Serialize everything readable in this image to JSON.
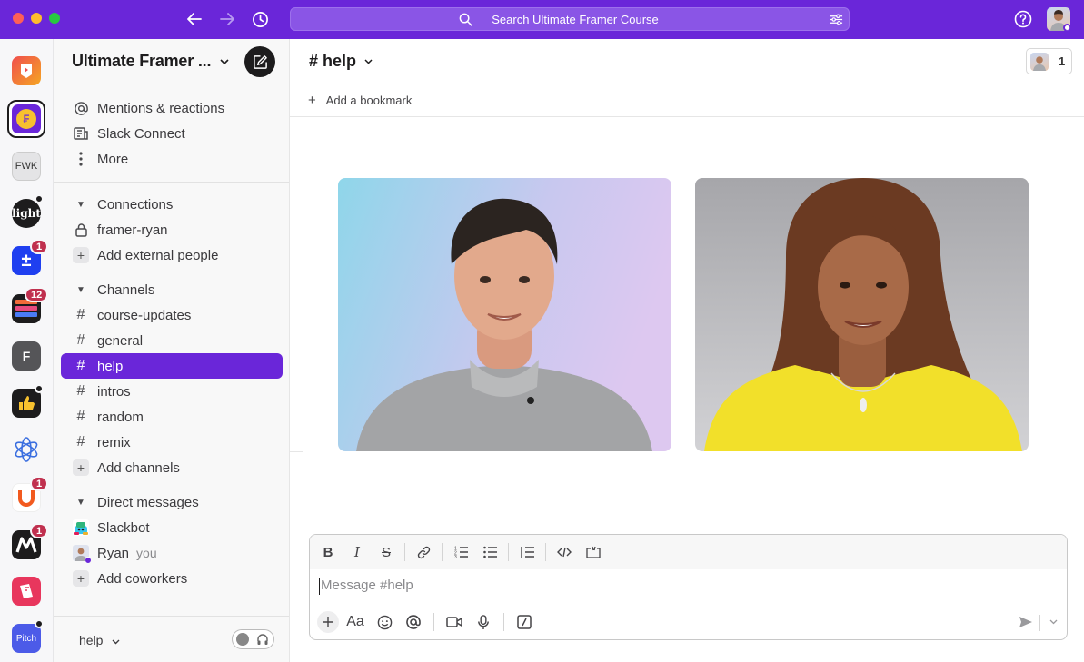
{
  "titlebar": {
    "search_placeholder": "Search Ultimate Framer Course"
  },
  "rail": {
    "workspaces": [
      {
        "name": "workspace-1",
        "label": ""
      },
      {
        "name": "ultimate-framer-course",
        "label": "",
        "active": true
      },
      {
        "name": "fwk",
        "label": "FWK"
      },
      {
        "name": "light",
        "label": "light",
        "dot": true
      },
      {
        "name": "workspace-plusminus",
        "label": "±",
        "badge": "1"
      },
      {
        "name": "workspace-stack",
        "label": "",
        "badge": "12"
      },
      {
        "name": "workspace-f",
        "label": "F"
      },
      {
        "name": "workspace-thumbs",
        "label": "",
        "dot": true
      },
      {
        "name": "workspace-flower",
        "label": ""
      },
      {
        "name": "workspace-u",
        "label": "",
        "badge": "1"
      },
      {
        "name": "workspace-m",
        "label": "",
        "badge": "1"
      },
      {
        "name": "workspace-red",
        "label": ""
      },
      {
        "name": "pitch",
        "label": "Pitch",
        "dot": true
      }
    ]
  },
  "sidebar": {
    "workspace_name": "Ultimate Framer ...",
    "top_items": [
      {
        "label": "Mentions & reactions"
      },
      {
        "label": "Slack Connect"
      },
      {
        "label": "More"
      }
    ],
    "connections": {
      "title": "Connections",
      "items": [
        {
          "label": "framer-ryan"
        },
        {
          "label": "Add external people"
        }
      ]
    },
    "channels": {
      "title": "Channels",
      "items": [
        {
          "label": "course-updates"
        },
        {
          "label": "general"
        },
        {
          "label": "help",
          "active": true
        },
        {
          "label": "intros"
        },
        {
          "label": "random"
        },
        {
          "label": "remix"
        },
        {
          "label": "Add channels"
        }
      ]
    },
    "direct_messages": {
      "title": "Direct messages",
      "items": [
        {
          "label": "Slackbot"
        },
        {
          "label": "Ryan",
          "suffix": "you"
        },
        {
          "label": "Add coworkers"
        }
      ]
    },
    "footer_label": "help"
  },
  "channel": {
    "title": "# help",
    "member_count": "1",
    "bookmark_label": "Add a bookmark"
  },
  "composer": {
    "placeholder": "Message #help",
    "format_aa": "Aa"
  },
  "colors": {
    "accent": "#6a26d9",
    "badge": "#c0304f"
  }
}
